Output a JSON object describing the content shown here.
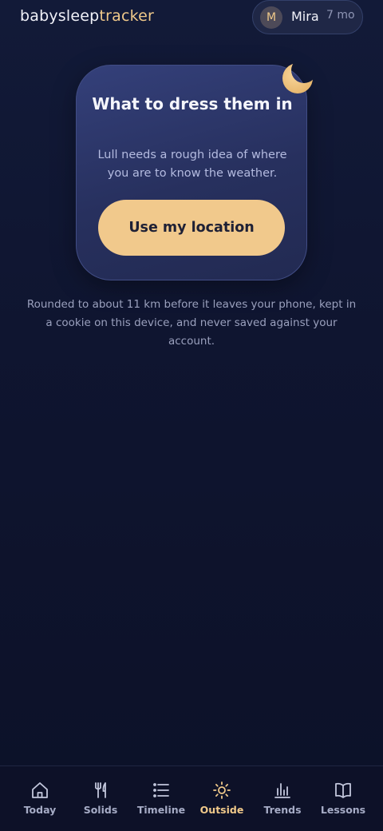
{
  "header": {
    "brand_part1": "babysleep",
    "brand_part2": "tracker",
    "profile": {
      "initial": "M",
      "name": "Mira",
      "age": "7 mo"
    }
  },
  "card": {
    "title": "What to dress them in",
    "subtitle": "Lull needs a rough idea of where you are to know the weather.",
    "button_label": "Use my location",
    "decor_icon": "moon-icon"
  },
  "privacy_note": "Rounded to about 11 km before it leaves your phone, kept in a cookie on this device, and never saved against your account.",
  "nav": {
    "active": "Outside",
    "items": [
      {
        "label": "Today",
        "icon": "home-icon"
      },
      {
        "label": "Solids",
        "icon": "fork-knife-icon"
      },
      {
        "label": "Timeline",
        "icon": "list-icon"
      },
      {
        "label": "Outside",
        "icon": "sun-icon"
      },
      {
        "label": "Trends",
        "icon": "bar-chart-icon"
      },
      {
        "label": "Lessons",
        "icon": "book-icon"
      }
    ]
  },
  "colors": {
    "accent": "#f1c98c",
    "background": "#0f1530",
    "card": "#2b3466",
    "muted_text": "#9aa0bd"
  }
}
